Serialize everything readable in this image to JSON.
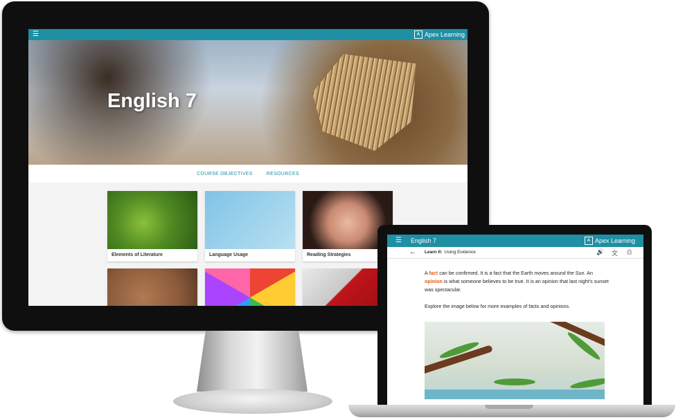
{
  "desktop": {
    "brand": "Apex Learning",
    "course_title": "English 7",
    "nav": [
      "COURSE OBJECTIVES",
      "RESOURCES"
    ],
    "cards": [
      {
        "label": "Elements of Literature"
      },
      {
        "label": "Language Usage"
      },
      {
        "label": "Reading Strategies"
      },
      {
        "label": ""
      },
      {
        "label": ""
      },
      {
        "label": ""
      }
    ]
  },
  "laptop": {
    "course_title": "English 7",
    "brand": "Apex Learning",
    "breadcrumb_bold": "Learn It:",
    "breadcrumb_text": "Using Evidence",
    "paragraph1": {
      "a": "A ",
      "fact": "fact",
      "b": " can be confirmed. It is a fact that the Earth moves around the Sun. An ",
      "opinion": "opinion",
      "c": " is what someone believes to be true. It is an opinion that last night's sunset was spectacular."
    },
    "paragraph2": "Explore the image below for more examples of facts and opinions."
  },
  "colors": {
    "teal": "#1f8fa3",
    "highlight": "#e35a12"
  },
  "icons": [
    "menu-icon",
    "back-arrow-icon",
    "audio-icon",
    "translate-icon",
    "print-icon"
  ]
}
